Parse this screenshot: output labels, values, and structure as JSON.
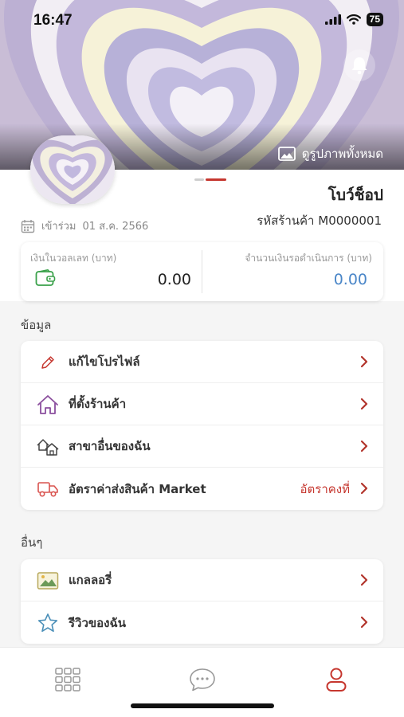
{
  "status_bar": {
    "time": "16:47",
    "battery": "75"
  },
  "banner": {
    "view_all_label": "ดูรูปภาพทั้งหมด"
  },
  "profile": {
    "shop_name": "โบว์ช็อป",
    "shop_code": "รหัสร้านค้า M0000001",
    "joined_label": "เข้าร่วม",
    "joined_date": "01 ส.ค. 2566"
  },
  "wallet": {
    "balance_label": "เงินในวอลเลท (บาท)",
    "balance_value": "0.00",
    "pending_label": "จำนวนเงินรอดำเนินการ (บาท)",
    "pending_value": "0.00"
  },
  "info_section": {
    "title": "ข้อมูล",
    "items": [
      {
        "label": "แก้ไขโปรไฟล์",
        "icon": "pencil-icon"
      },
      {
        "label": "ที่ตั้งร้านค้า",
        "icon": "home-icon"
      },
      {
        "label": "สาขาอื่นของฉัน",
        "icon": "branches-icon"
      },
      {
        "label": "อัตราค่าส่งสินค้า Market",
        "icon": "truck-icon",
        "extra": "อัตราคงที่"
      }
    ]
  },
  "other_section": {
    "title": "อื่นๆ",
    "items": [
      {
        "label": "แกลลอรี่",
        "icon": "gallery-icon"
      },
      {
        "label": "รีวิวของฉัน",
        "icon": "star-icon"
      }
    ]
  },
  "colors": {
    "accent": "#c6372f",
    "pending_value": "#4a86c8"
  }
}
